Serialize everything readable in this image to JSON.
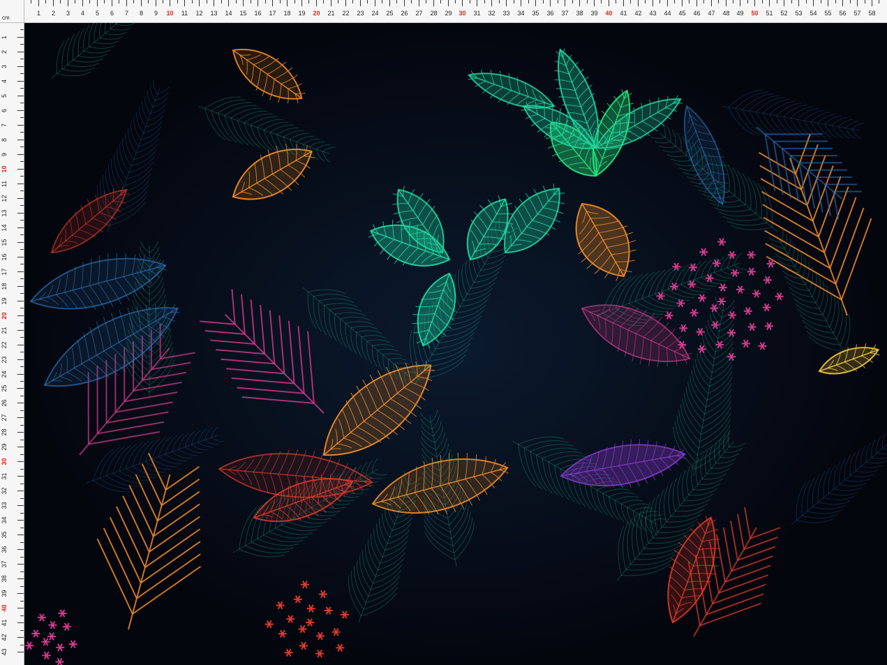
{
  "ruler": {
    "unit_label": "cm",
    "top_max": 59,
    "left_max": 43,
    "highlight_every": 10,
    "tick_color": "#333333",
    "highlight_color": "#d42a1a"
  },
  "artwork": {
    "colors": {
      "background": "#05060f",
      "teal": "#1ed6a0",
      "green": "#22e27a",
      "orange": "#f08a24",
      "yellow": "#f6c93a",
      "magenta": "#d43a8c",
      "blue": "#2a6fb0",
      "purple": "#8a3ad0",
      "red": "#e03a2a"
    }
  }
}
